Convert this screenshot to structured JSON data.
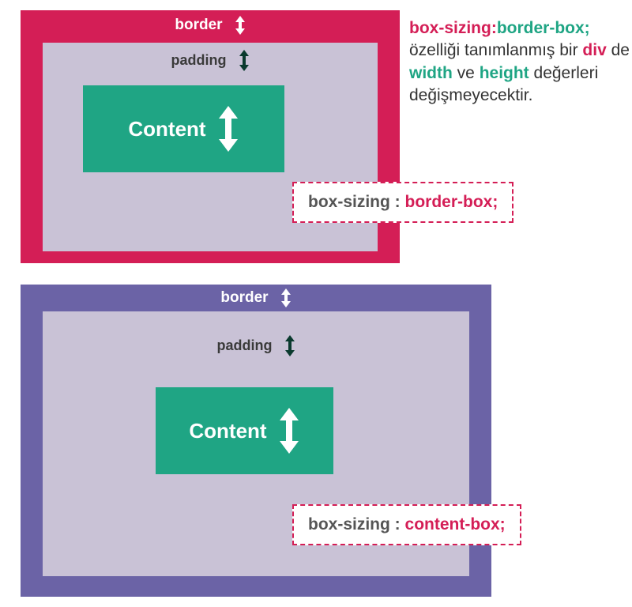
{
  "diagram1": {
    "border_label": "border",
    "padding_label": "padding",
    "content_label": "Content",
    "badge_property": "box-sizing :",
    "badge_value": "border-box;"
  },
  "diagram2": {
    "border_label": "border",
    "padding_label": "padding",
    "content_label": "Content",
    "badge_property": "box-sizing :",
    "badge_value": "content-box;"
  },
  "explain": {
    "part1": "box-sizing:",
    "part2": "border-box;",
    "part3": "özelliği tanımlanmış bir ",
    "part4": "div",
    "part5": " de ",
    "part6": "width",
    "part7": " ve ",
    "part8": "height",
    "part9": " değerleri değişmeyecektir."
  },
  "chart_data": [
    {
      "type": "diagram",
      "title": "box-sizing: border-box",
      "layers": [
        "border",
        "padding",
        "Content"
      ],
      "annotation": "box-sizing : border-box;",
      "colors": {
        "border": "#d41e56",
        "padding": "#c9c2d6",
        "content": "#1fa584"
      }
    },
    {
      "type": "diagram",
      "title": "box-sizing: content-box",
      "layers": [
        "border",
        "padding",
        "Content"
      ],
      "annotation": "box-sizing : content-box;",
      "colors": {
        "border": "#6b63a6",
        "padding": "#c9c2d6",
        "content": "#1fa584"
      }
    }
  ]
}
